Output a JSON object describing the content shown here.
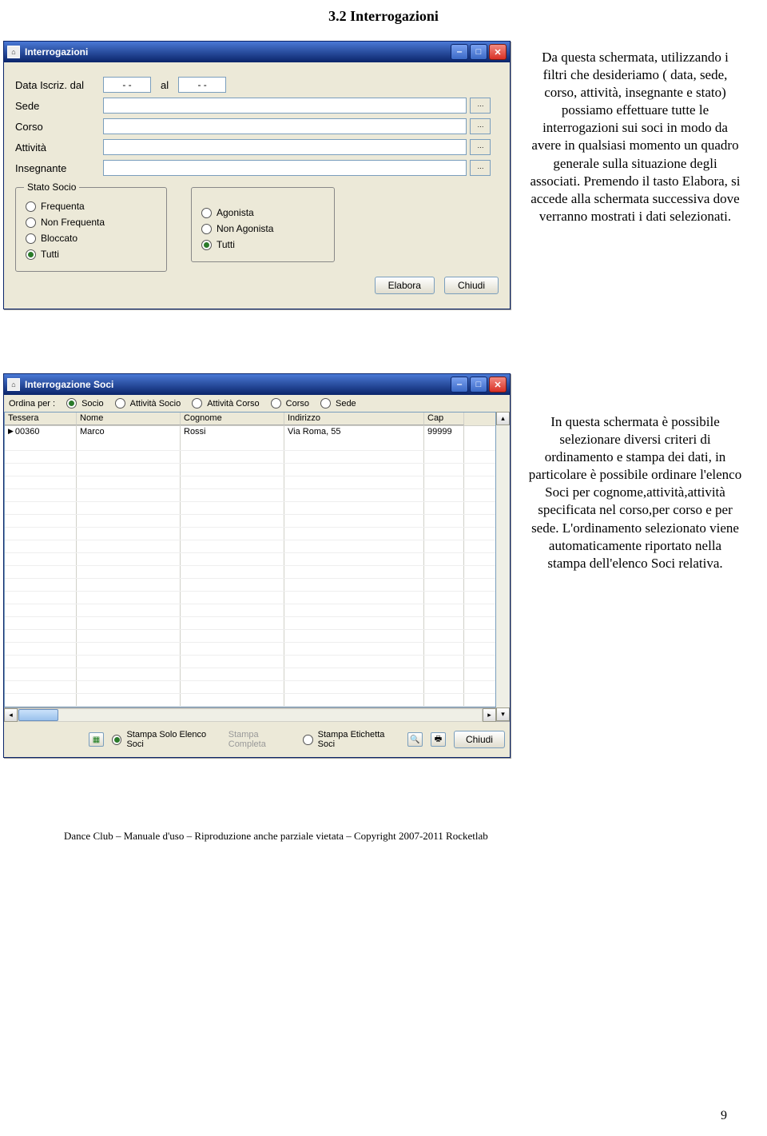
{
  "page": {
    "heading": "3.2 Interrogazioni",
    "number": "9",
    "footer": "Dance Club – Manuale d'uso – Riproduzione anche parziale vietata – Copyright 2007-2011 Rocketlab"
  },
  "win1": {
    "title": "Interrogazioni",
    "labels": {
      "data_iscriz": "Data Iscriz. dal",
      "al": "al",
      "sede": "Sede",
      "corso": "Corso",
      "attivita": "Attività",
      "insegnante": "Insegnante"
    },
    "values": {
      "data_from": "- -",
      "data_to": "- -",
      "sede": "",
      "corso": "",
      "attivita": "",
      "insegnante": ""
    },
    "group_stato": {
      "legend": "Stato Socio",
      "opts": [
        "Frequenta",
        "Non Frequenta",
        "Bloccato",
        "Tutti"
      ],
      "selected": 3
    },
    "group_tipo": {
      "opts": [
        "Agonista",
        "Non Agonista",
        "Tutti"
      ],
      "selected": 2
    },
    "buttons": {
      "elabora": "Elabora",
      "chiudi": "Chiudi"
    }
  },
  "desc1": "Da questa schermata, utilizzando i filtri che desideriamo ( data, sede, corso, attività, insegnante e stato) possiamo effettuare tutte le interrogazioni sui soci in modo da avere in qualsiasi momento un quadro generale sulla situazione degli associati. Premendo il tasto Elabora, si accede alla schermata successiva dove verranno mostrati i dati selezionati.",
  "win2": {
    "title": "Interrogazione Soci",
    "ordina_label": "Ordina per :",
    "ordina_opts": [
      "Socio",
      "Attività Socio",
      "Attività Corso",
      "Corso",
      "Sede"
    ],
    "ordina_selected": 0,
    "columns": [
      "Tessera",
      "Nome",
      "Cognome",
      "Indirizzo",
      "Cap"
    ],
    "rows": [
      {
        "tessera": "00360",
        "nome": "Marco",
        "cognome": "Rossi",
        "indirizzo": "Via Roma, 55",
        "cap": "99999"
      }
    ],
    "empty_row_count": 21,
    "bottom": {
      "stampa_elenco": {
        "label": "Stampa Solo Elenco Soci",
        "selected": true
      },
      "stampa_completa": {
        "label": "Stampa Completa",
        "disabled": true
      },
      "stampa_etichetta": {
        "label": "Stampa Etichetta Soci",
        "selected": false
      },
      "chiudi": "Chiudi"
    }
  },
  "desc2": "In questa schermata è possibile selezionare diversi criteri di ordinamento e stampa dei dati, in particolare è possibile ordinare l'elenco Soci per cognome,attività,attività specificata nel corso,per corso e per sede. L'ordinamento selezionato viene automaticamente riportato nella stampa dell'elenco Soci relativa."
}
